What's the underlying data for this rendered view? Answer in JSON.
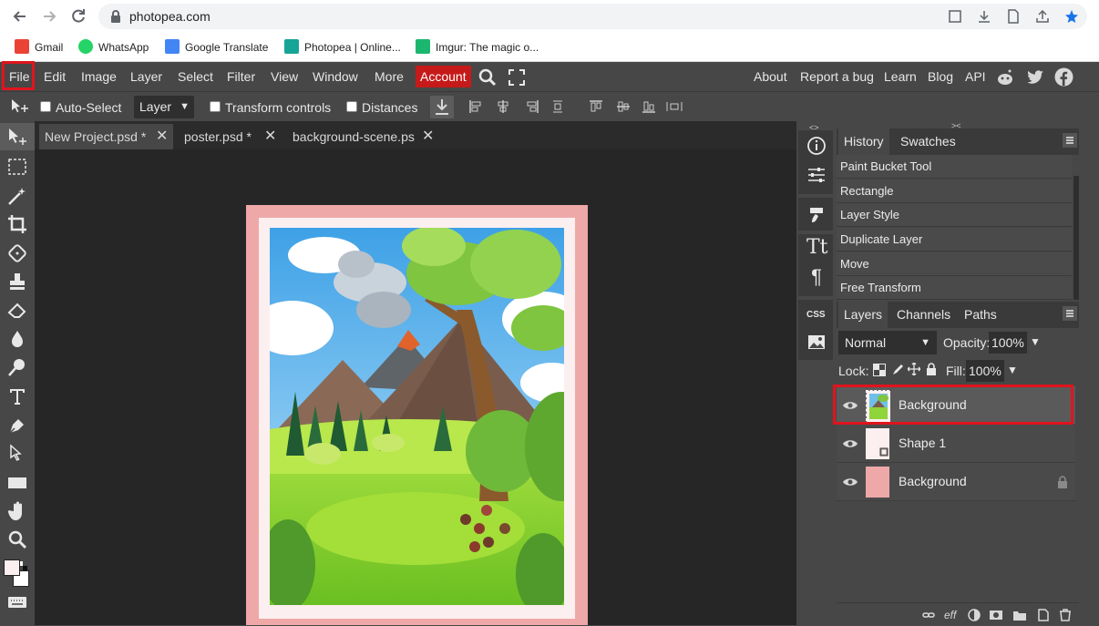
{
  "browser": {
    "url": "photopea.com",
    "bookmarks": [
      {
        "label": "Gmail",
        "color": "#ea4335"
      },
      {
        "label": "WhatsApp",
        "color": "#25d366"
      },
      {
        "label": "Google Translate",
        "color": "#4285f4"
      },
      {
        "label": "Photopea | Online...",
        "color": "#18a497"
      },
      {
        "label": "Imgur: The magic o...",
        "color": "#1bb76e"
      }
    ]
  },
  "menu": {
    "items": [
      "File",
      "Edit",
      "Image",
      "Layer",
      "Select",
      "Filter",
      "View",
      "Window",
      "More"
    ],
    "account": "Account",
    "right_links": [
      "About",
      "Report a bug",
      "Learn",
      "Blog",
      "API"
    ]
  },
  "options": {
    "auto_select": "Auto-Select",
    "layer_select": "Layer",
    "transform_controls": "Transform controls",
    "distances": "Distances"
  },
  "documents": [
    {
      "name": "New Project.psd *",
      "active": true
    },
    {
      "name": "poster.psd *",
      "active": false
    },
    {
      "name": "background-scene.ps",
      "active": false
    }
  ],
  "history": {
    "tabs": [
      "History",
      "Swatches"
    ],
    "items": [
      "Paint Bucket Tool",
      "Rectangle",
      "Layer Style",
      "Duplicate Layer",
      "Move",
      "Free Transform"
    ]
  },
  "layers": {
    "tabs": [
      "Layers",
      "Channels",
      "Paths"
    ],
    "blend_mode": "Normal",
    "opacity_label": "Opacity:",
    "opacity": "100%",
    "lock_label": "Lock:",
    "fill_label": "Fill:",
    "fill": "100%",
    "items": [
      {
        "name": "Background",
        "selected": true,
        "thumb": "scene"
      },
      {
        "name": "Shape 1",
        "selected": false,
        "thumb": "shape"
      },
      {
        "name": "Background",
        "selected": false,
        "thumb": "pink",
        "locked": true
      }
    ]
  },
  "colors": {
    "accent_red": "#e0141d",
    "account_red": "#c61a1a",
    "poster_pink": "#efa8a8",
    "poster_inner": "#fcefef"
  }
}
